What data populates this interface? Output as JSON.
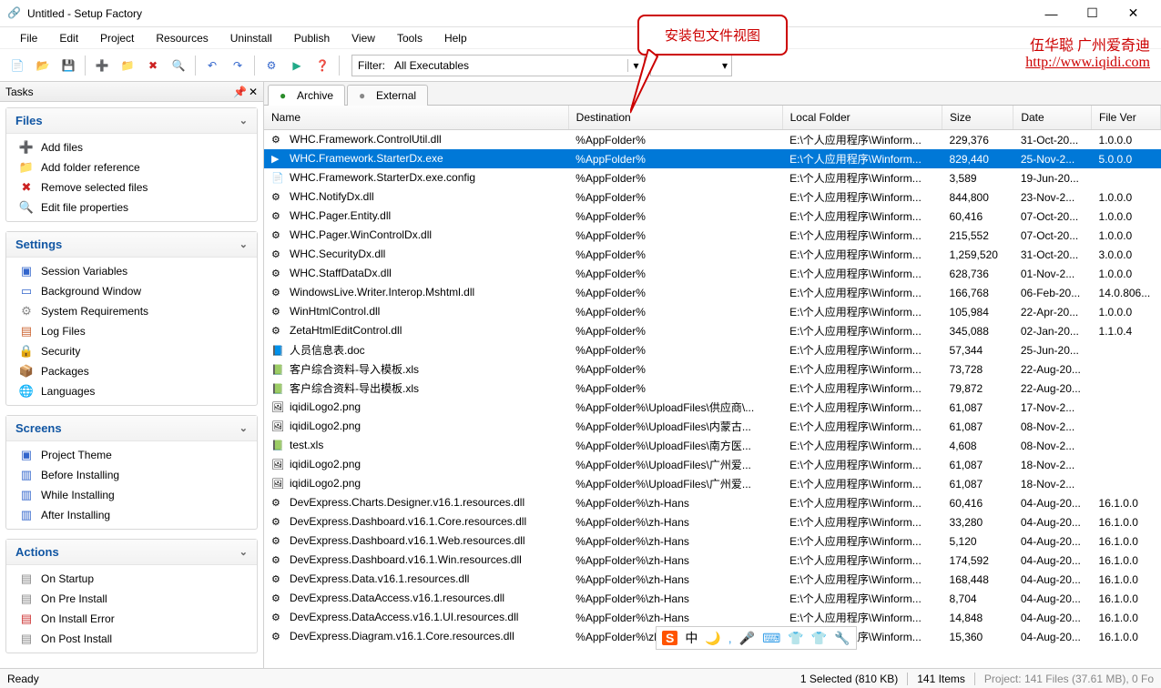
{
  "window": {
    "title": "Untitled - Setup Factory"
  },
  "menu": [
    "File",
    "Edit",
    "Project",
    "Resources",
    "Uninstall",
    "Publish",
    "View",
    "Tools",
    "Help"
  ],
  "filter": {
    "label": "Filter:",
    "value": "All Executables"
  },
  "tasks_title": "Tasks",
  "groups": [
    {
      "title": "Files",
      "items": [
        {
          "icon": "➕",
          "color": "#2a8",
          "label": "Add files"
        },
        {
          "icon": "📁",
          "color": "#d90",
          "label": "Add folder reference"
        },
        {
          "icon": "✖",
          "color": "#c22",
          "label": "Remove selected files"
        },
        {
          "icon": "🔍",
          "color": "#888",
          "label": "Edit file properties"
        }
      ]
    },
    {
      "title": "Settings",
      "items": [
        {
          "icon": "▣",
          "color": "#36c",
          "label": "Session Variables"
        },
        {
          "icon": "▭",
          "color": "#36c",
          "label": "Background Window"
        },
        {
          "icon": "⚙",
          "color": "#888",
          "label": "System Requirements"
        },
        {
          "icon": "▤",
          "color": "#c63",
          "label": "Log Files"
        },
        {
          "icon": "🔒",
          "color": "#c90",
          "label": "Security"
        },
        {
          "icon": "📦",
          "color": "#c90",
          "label": "Packages"
        },
        {
          "icon": "🌐",
          "color": "#36c",
          "label": "Languages"
        }
      ]
    },
    {
      "title": "Screens",
      "items": [
        {
          "icon": "▣",
          "color": "#36c",
          "label": "Project Theme"
        },
        {
          "icon": "▥",
          "color": "#36c",
          "label": "Before Installing"
        },
        {
          "icon": "▥",
          "color": "#36c",
          "label": "While Installing"
        },
        {
          "icon": "▥",
          "color": "#36c",
          "label": "After Installing"
        }
      ]
    },
    {
      "title": "Actions",
      "items": [
        {
          "icon": "▤",
          "color": "#888",
          "label": "On Startup"
        },
        {
          "icon": "▤",
          "color": "#888",
          "label": "On Pre Install"
        },
        {
          "icon": "▤",
          "color": "#c33",
          "label": "On Install Error"
        },
        {
          "icon": "▤",
          "color": "#888",
          "label": "On Post Install"
        }
      ]
    }
  ],
  "tabs": [
    {
      "label": "Archive",
      "active": true,
      "icon": "#2a8c2a"
    },
    {
      "label": "External",
      "active": false,
      "icon": "#888"
    }
  ],
  "columns": [
    "Name",
    "Destination",
    "Local Folder",
    "Size",
    "Date",
    "File Ver"
  ],
  "rows": [
    {
      "sel": false,
      "icon": "dll",
      "name": "WHC.Framework.ControlUtil.dll",
      "dest": "%AppFolder%",
      "folder": "E:\\个人应用程序\\Winform...",
      "size": "229,376",
      "date": "31-Oct-20...",
      "ver": "1.0.0.0"
    },
    {
      "sel": true,
      "icon": "exe",
      "name": "WHC.Framework.StarterDx.exe",
      "dest": "%AppFolder%",
      "folder": "E:\\个人应用程序\\Winform...",
      "size": "829,440",
      "date": "25-Nov-2...",
      "ver": "5.0.0.0"
    },
    {
      "sel": false,
      "icon": "cfg",
      "name": "WHC.Framework.StarterDx.exe.config",
      "dest": "%AppFolder%",
      "folder": "E:\\个人应用程序\\Winform...",
      "size": "3,589",
      "date": "19-Jun-20...",
      "ver": ""
    },
    {
      "sel": false,
      "icon": "dll",
      "name": "WHC.NotifyDx.dll",
      "dest": "%AppFolder%",
      "folder": "E:\\个人应用程序\\Winform...",
      "size": "844,800",
      "date": "23-Nov-2...",
      "ver": "1.0.0.0"
    },
    {
      "sel": false,
      "icon": "dll",
      "name": "WHC.Pager.Entity.dll",
      "dest": "%AppFolder%",
      "folder": "E:\\个人应用程序\\Winform...",
      "size": "60,416",
      "date": "07-Oct-20...",
      "ver": "1.0.0.0"
    },
    {
      "sel": false,
      "icon": "dll",
      "name": "WHC.Pager.WinControlDx.dll",
      "dest": "%AppFolder%",
      "folder": "E:\\个人应用程序\\Winform...",
      "size": "215,552",
      "date": "07-Oct-20...",
      "ver": "1.0.0.0"
    },
    {
      "sel": false,
      "icon": "dll",
      "name": "WHC.SecurityDx.dll",
      "dest": "%AppFolder%",
      "folder": "E:\\个人应用程序\\Winform...",
      "size": "1,259,520",
      "date": "31-Oct-20...",
      "ver": "3.0.0.0"
    },
    {
      "sel": false,
      "icon": "dll",
      "name": "WHC.StaffDataDx.dll",
      "dest": "%AppFolder%",
      "folder": "E:\\个人应用程序\\Winform...",
      "size": "628,736",
      "date": "01-Nov-2...",
      "ver": "1.0.0.0"
    },
    {
      "sel": false,
      "icon": "dll",
      "name": "WindowsLive.Writer.Interop.Mshtml.dll",
      "dest": "%AppFolder%",
      "folder": "E:\\个人应用程序\\Winform...",
      "size": "166,768",
      "date": "06-Feb-20...",
      "ver": "14.0.806..."
    },
    {
      "sel": false,
      "icon": "dll",
      "name": "WinHtmlControl.dll",
      "dest": "%AppFolder%",
      "folder": "E:\\个人应用程序\\Winform...",
      "size": "105,984",
      "date": "22-Apr-20...",
      "ver": "1.0.0.0"
    },
    {
      "sel": false,
      "icon": "dll",
      "name": "ZetaHtmlEditControl.dll",
      "dest": "%AppFolder%",
      "folder": "E:\\个人应用程序\\Winform...",
      "size": "345,088",
      "date": "02-Jan-20...",
      "ver": "1.1.0.4"
    },
    {
      "sel": false,
      "icon": "doc",
      "name": "人员信息表.doc",
      "dest": "%AppFolder%",
      "folder": "E:\\个人应用程序\\Winform...",
      "size": "57,344",
      "date": "25-Jun-20...",
      "ver": ""
    },
    {
      "sel": false,
      "icon": "xls",
      "name": "客户综合资料-导入模板.xls",
      "dest": "%AppFolder%",
      "folder": "E:\\个人应用程序\\Winform...",
      "size": "73,728",
      "date": "22-Aug-20...",
      "ver": ""
    },
    {
      "sel": false,
      "icon": "xls",
      "name": "客户综合资料-导出模板.xls",
      "dest": "%AppFolder%",
      "folder": "E:\\个人应用程序\\Winform...",
      "size": "79,872",
      "date": "22-Aug-20...",
      "ver": ""
    },
    {
      "sel": false,
      "icon": "png",
      "name": "iqidiLogo2.png",
      "dest": "%AppFolder%\\UploadFiles\\供应商\\...",
      "folder": "E:\\个人应用程序\\Winform...",
      "size": "61,087",
      "date": "17-Nov-2...",
      "ver": ""
    },
    {
      "sel": false,
      "icon": "png",
      "name": "iqidiLogo2.png",
      "dest": "%AppFolder%\\UploadFiles\\内蒙古...",
      "folder": "E:\\个人应用程序\\Winform...",
      "size": "61,087",
      "date": "08-Nov-2...",
      "ver": ""
    },
    {
      "sel": false,
      "icon": "xls",
      "name": "test.xls",
      "dest": "%AppFolder%\\UploadFiles\\南方医...",
      "folder": "E:\\个人应用程序\\Winform...",
      "size": "4,608",
      "date": "08-Nov-2...",
      "ver": ""
    },
    {
      "sel": false,
      "icon": "png",
      "name": "iqidiLogo2.png",
      "dest": "%AppFolder%\\UploadFiles\\广州爱...",
      "folder": "E:\\个人应用程序\\Winform...",
      "size": "61,087",
      "date": "18-Nov-2...",
      "ver": ""
    },
    {
      "sel": false,
      "icon": "png",
      "name": "iqidiLogo2.png",
      "dest": "%AppFolder%\\UploadFiles\\广州爱...",
      "folder": "E:\\个人应用程序\\Winform...",
      "size": "61,087",
      "date": "18-Nov-2...",
      "ver": ""
    },
    {
      "sel": false,
      "icon": "dll",
      "name": "DevExpress.Charts.Designer.v16.1.resources.dll",
      "dest": "%AppFolder%\\zh-Hans",
      "folder": "E:\\个人应用程序\\Winform...",
      "size": "60,416",
      "date": "04-Aug-20...",
      "ver": "16.1.0.0"
    },
    {
      "sel": false,
      "icon": "dll",
      "name": "DevExpress.Dashboard.v16.1.Core.resources.dll",
      "dest": "%AppFolder%\\zh-Hans",
      "folder": "E:\\个人应用程序\\Winform...",
      "size": "33,280",
      "date": "04-Aug-20...",
      "ver": "16.1.0.0"
    },
    {
      "sel": false,
      "icon": "dll",
      "name": "DevExpress.Dashboard.v16.1.Web.resources.dll",
      "dest": "%AppFolder%\\zh-Hans",
      "folder": "E:\\个人应用程序\\Winform...",
      "size": "5,120",
      "date": "04-Aug-20...",
      "ver": "16.1.0.0"
    },
    {
      "sel": false,
      "icon": "dll",
      "name": "DevExpress.Dashboard.v16.1.Win.resources.dll",
      "dest": "%AppFolder%\\zh-Hans",
      "folder": "E:\\个人应用程序\\Winform...",
      "size": "174,592",
      "date": "04-Aug-20...",
      "ver": "16.1.0.0"
    },
    {
      "sel": false,
      "icon": "dll",
      "name": "DevExpress.Data.v16.1.resources.dll",
      "dest": "%AppFolder%\\zh-Hans",
      "folder": "E:\\个人应用程序\\Winform...",
      "size": "168,448",
      "date": "04-Aug-20...",
      "ver": "16.1.0.0"
    },
    {
      "sel": false,
      "icon": "dll",
      "name": "DevExpress.DataAccess.v16.1.resources.dll",
      "dest": "%AppFolder%\\zh-Hans",
      "folder": "E:\\个人应用程序\\Winform...",
      "size": "8,704",
      "date": "04-Aug-20...",
      "ver": "16.1.0.0"
    },
    {
      "sel": false,
      "icon": "dll",
      "name": "DevExpress.DataAccess.v16.1.UI.resources.dll",
      "dest": "%AppFolder%\\zh-Hans",
      "folder": "E:\\个人应用程序\\Winform...",
      "size": "14,848",
      "date": "04-Aug-20...",
      "ver": "16.1.0.0"
    },
    {
      "sel": false,
      "icon": "dll",
      "name": "DevExpress.Diagram.v16.1.Core.resources.dll",
      "dest": "%AppFolder%\\zh-Hans",
      "folder": "E:\\个人应用程序\\Winform...",
      "size": "15,360",
      "date": "04-Aug-20...",
      "ver": "16.1.0.0"
    }
  ],
  "status": {
    "ready": "Ready",
    "selected": "1 Selected (810 KB)",
    "items": "141 Items",
    "project": "Project: 141 Files (37.61 MB), 0 Fo"
  },
  "callout_text": "安装包文件视图",
  "annot1": "伍华聪 广州爱奇迪",
  "annot2": "http://www.iqidi.com",
  "ime": [
    "S",
    "中",
    "🌙",
    ",",
    "🎤",
    "⌨",
    "👕",
    "👕",
    "🔧"
  ]
}
